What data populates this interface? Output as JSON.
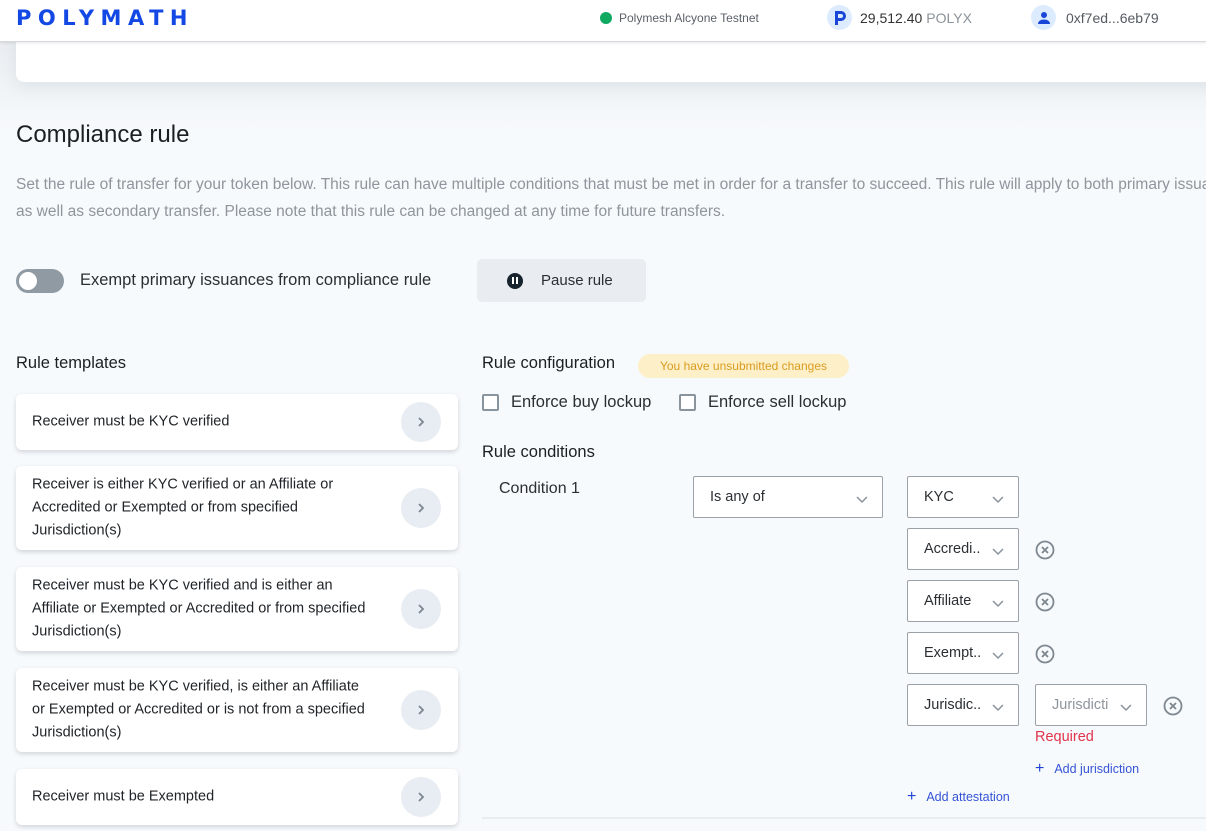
{
  "header": {
    "logo": "POLYMATH",
    "network": "Polymesh Alcyone Testnet",
    "network_status_color": "#0fa961",
    "balance_amount": "29,512.40",
    "balance_unit": "POLYX",
    "account": "0xf7ed...6eb79",
    "brand_color": "#1348e4"
  },
  "page": {
    "title": "Compliance rule",
    "description": "Set the rule of transfer for your token below. This rule can have multiple conditions that must be met in order for a transfer to succeed. This rule will apply to both primary issuances; as well as secondary transfer. Please note that this rule can be changed at any time for future transfers."
  },
  "controls": {
    "exempt_toggle_label": "Exempt primary issuances from compliance rule",
    "exempt_toggle_on": false,
    "pause_label": "Pause rule"
  },
  "templates": {
    "heading": "Rule templates",
    "items": [
      {
        "label": "Receiver must be KYC verified"
      },
      {
        "label": "Receiver is either KYC verified or an Affiliate or Accredited or Exempted or from specified Jurisdiction(s)"
      },
      {
        "label": "Receiver must be KYC verified and is either an Affiliate or Exempted or Accredited or from specified Jurisdiction(s)"
      },
      {
        "label": "Receiver must be KYC verified, is either an Affiliate or Exempted or Accredited or is not from a specified Jurisdiction(s)"
      },
      {
        "label": "Receiver must be Exempted"
      }
    ]
  },
  "configuration": {
    "heading": "Rule configuration",
    "badge": "You have unsubmitted changes",
    "buy_lockup_label": "Enforce buy lockup",
    "buy_lockup_checked": false,
    "sell_lockup_label": "Enforce sell lockup",
    "sell_lockup_checked": false
  },
  "conditions": {
    "heading": "Rule conditions",
    "items": [
      {
        "label": "Condition 1",
        "operator": "Is any of",
        "attestations": [
          {
            "value": "KYC"
          },
          {
            "value": "Accredi.."
          },
          {
            "value": "Affiliate"
          },
          {
            "value": "Exempt.."
          },
          {
            "value": "Jurisdic..",
            "jurisdiction_placeholder": "Jurisdicti",
            "jurisdiction_error": "Required"
          }
        ],
        "add_jurisdiction_label": "Add jurisdiction",
        "add_attestation_label": "Add attestation"
      }
    ]
  }
}
